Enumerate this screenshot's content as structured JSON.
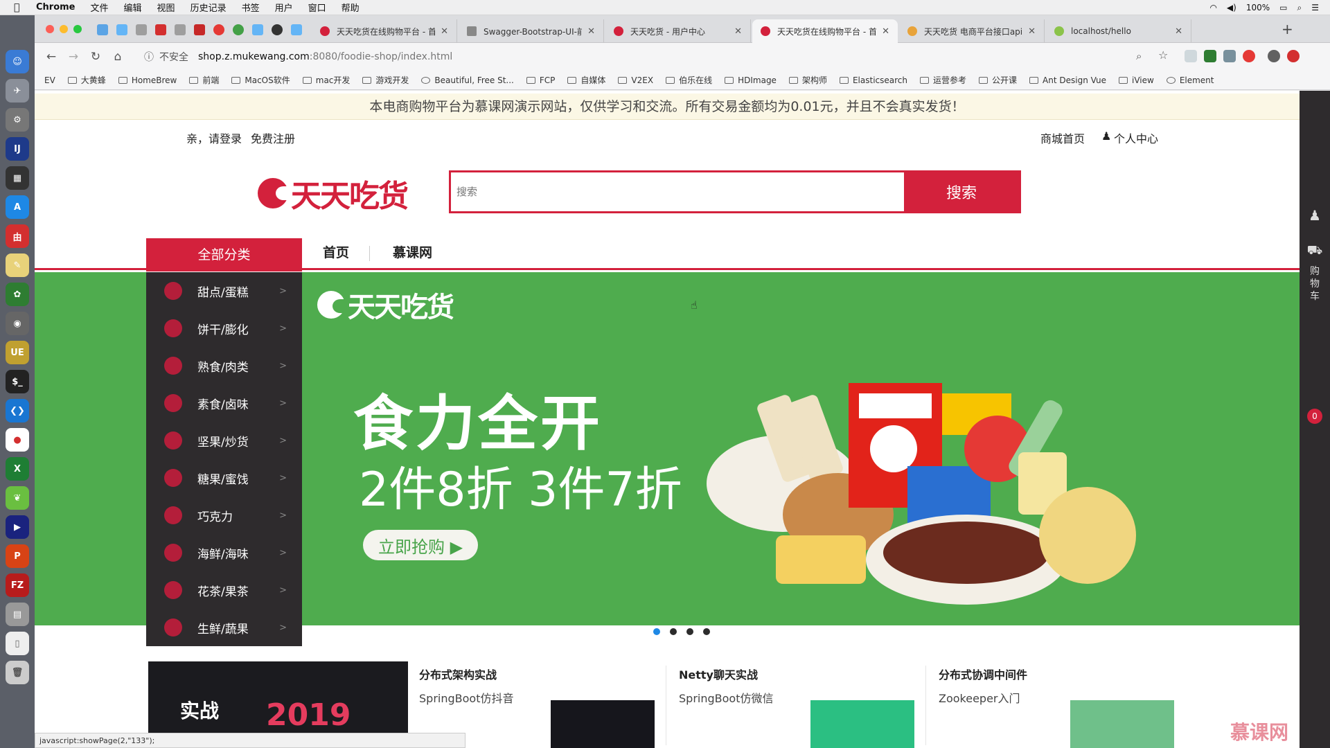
{
  "menubar": {
    "app": "Chrome",
    "items": [
      "文件",
      "编辑",
      "视图",
      "历史记录",
      "书签",
      "用户",
      "窗口",
      "帮助"
    ],
    "battery": "100%"
  },
  "tabs": [
    {
      "title": "天天吃货在线购物平台 - 首",
      "color": "#d3213c"
    },
    {
      "title": "Swagger-Bootstrap-UI-前",
      "color": "#888888"
    },
    {
      "title": "天天吃货 - 用户中心",
      "color": "#d3213c"
    },
    {
      "title": "天天吃货在线购物平台 - 首",
      "color": "#d3213c"
    },
    {
      "title": "天天吃货 电商平台接口api",
      "color": "#e8a33a"
    },
    {
      "title": "localhost/hello",
      "color": "#8bc34a"
    }
  ],
  "address": {
    "security": "不安全",
    "domain": "shop.z.mukewang.com",
    "path": ":8080/foodie-shop/index.html"
  },
  "bookmarks": [
    "EV",
    "大黄蜂",
    "HomeBrew",
    "前端",
    "MacOS软件",
    "mac开发",
    "游戏开发",
    "Beautiful, Free St...",
    "FCP",
    "自媒体",
    "V2EX",
    "伯乐在线",
    "HDImage",
    "架构师",
    "Elasticsearch",
    "运营参考",
    "公开课",
    "Ant Design Vue",
    "iView",
    "Element"
  ],
  "notice": "本电商购物平台为慕课网演示网站，仅供学习和交流。所有交易金额均为0.01元，并且不会真实发货！",
  "topnav": {
    "login": "亲，请登录",
    "register": "免费注册",
    "home": "商城首页",
    "user_center": "个人中心"
  },
  "logo": "天天吃货",
  "search": {
    "placeholder": "搜索",
    "button": "搜索"
  },
  "nav": {
    "all_categories": "全部分类",
    "home": "首页",
    "imooc": "慕课网"
  },
  "categories": [
    "甜点/蛋糕",
    "饼干/膨化",
    "熟食/肉类",
    "素食/卤味",
    "坚果/炒货",
    "糖果/蜜饯",
    "巧克力",
    "海鲜/海味",
    "花茶/果茶",
    "生鲜/蔬果"
  ],
  "banner": {
    "logo": "天天吃货",
    "headline": "食力全开",
    "subline": "2件8折 3件7折",
    "cta": "立即抢购 ▶",
    "slides": 4,
    "active_slide": 0
  },
  "courses": [
    {
      "thumb_text": "实战",
      "year": "2019"
    },
    {
      "title": "分布式架构实战",
      "subtitle": "SpringBoot仿抖音"
    },
    {
      "title": "Netty聊天实战",
      "subtitle": "SpringBoot仿微信"
    },
    {
      "title": "分布式协调中间件",
      "subtitle": "Zookeeper入门"
    }
  ],
  "sidebar": {
    "cart": "购物车",
    "cart_count": "0"
  },
  "status": "javascript:showPage(2,\"133\");",
  "watermark": "慕课网",
  "colors": {
    "brand": "#d3213c",
    "banner": "#4fac4e"
  }
}
